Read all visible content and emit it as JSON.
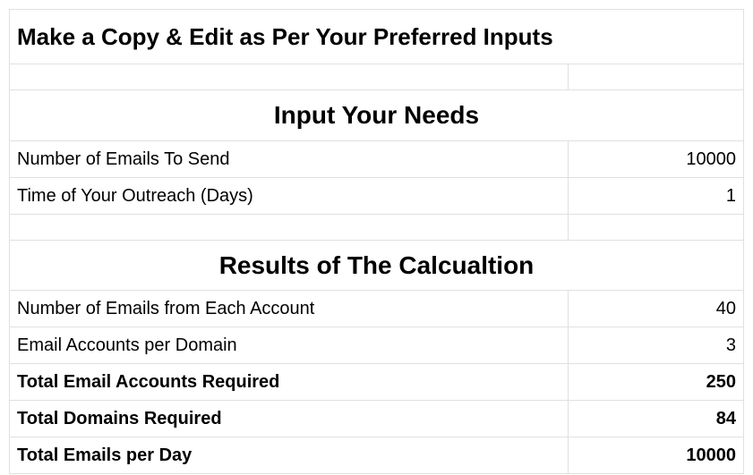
{
  "title": "Make a Copy & Edit as Per Your Preferred Inputs",
  "sections": {
    "inputs": {
      "header": "Input Your Needs",
      "rows": [
        {
          "label": "Number of Emails To Send",
          "value": "10000"
        },
        {
          "label": "Time of Your Outreach (Days)",
          "value": "1"
        }
      ]
    },
    "results": {
      "header": "Results of The Calcualtion",
      "rows": [
        {
          "label": "Number of Emails from Each Account",
          "value": "40",
          "bold": false
        },
        {
          "label": "Email Accounts per Domain",
          "value": "3",
          "bold": false
        },
        {
          "label": "Total Email Accounts Required",
          "value": "250",
          "bold": true
        },
        {
          "label": "Total Domains Required",
          "value": "84",
          "bold": true
        },
        {
          "label": "Total Emails per Day",
          "value": "10000",
          "bold": true
        }
      ]
    }
  }
}
